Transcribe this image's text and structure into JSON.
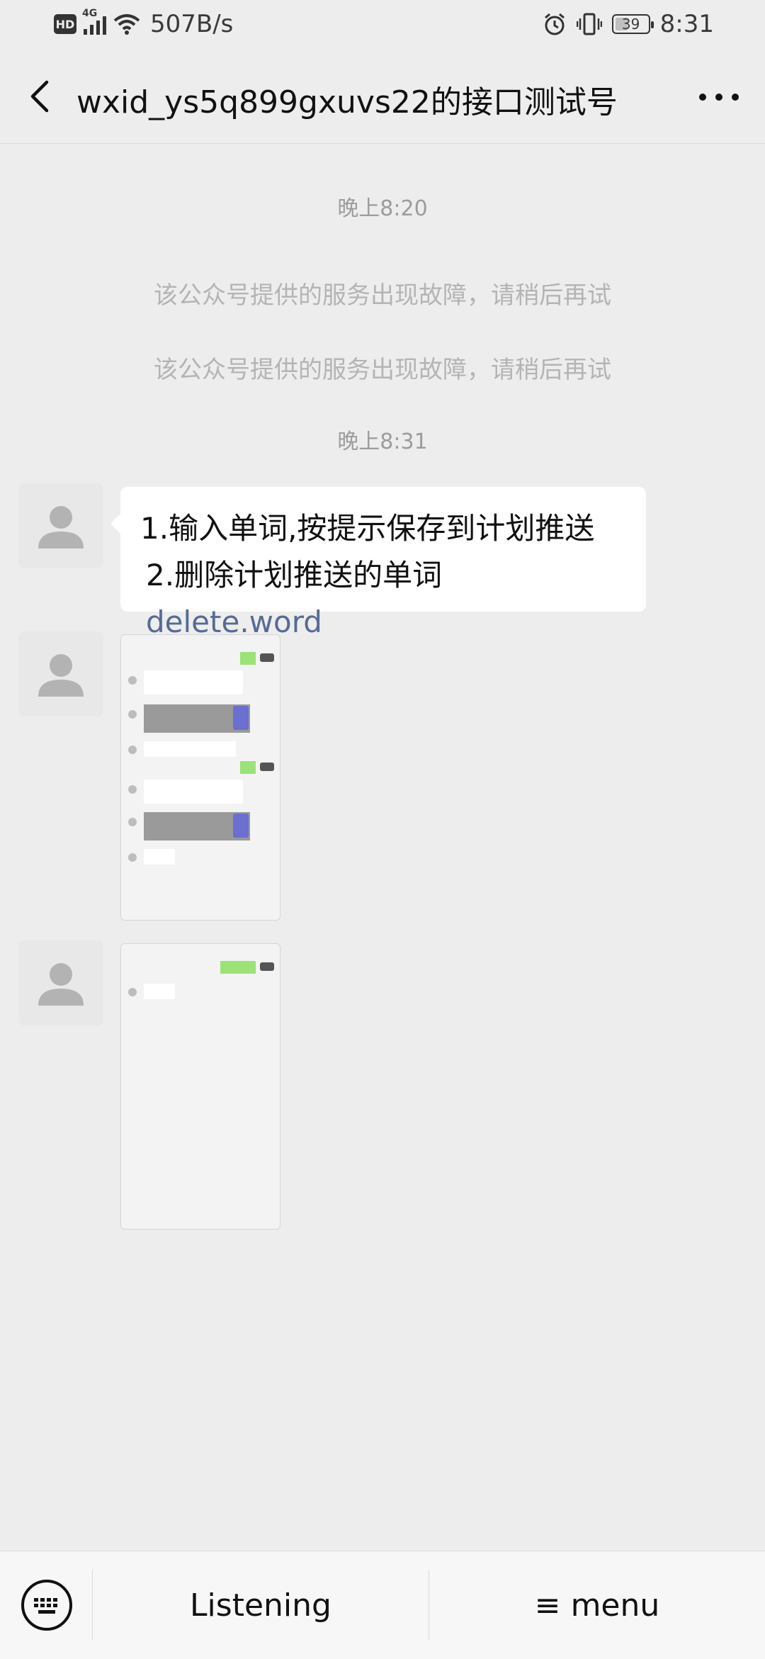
{
  "status_bar": {
    "hd": "HD",
    "network": "4G",
    "speed": "507B/s",
    "battery": "39",
    "battery_level_percent": 39,
    "time": "8:31"
  },
  "header": {
    "title": "wxid_ys5q899gxuvs22的接口测试号"
  },
  "messages": {
    "time_1": "晚上8:20",
    "system_1": "该公众号提供的服务出现故障，请稍后再试",
    "system_2": "该公众号提供的服务出现故障，请稍后再试",
    "time_2": "晚上8:31",
    "text_line_1": "1.输入单词,按提示保存到计划推送",
    "text_line_2_prefix": "2.删除计划推送的单词 ",
    "text_line_2_link": "delete.word"
  },
  "bottom_bar": {
    "keyboard_icon": "keyboard-icon",
    "listening_label": "Listening",
    "menu_label": "≡ menu"
  },
  "colors": {
    "background": "#ededed",
    "bubble": "#ffffff",
    "link": "#566b94",
    "system_text": "#b4b4b4"
  }
}
